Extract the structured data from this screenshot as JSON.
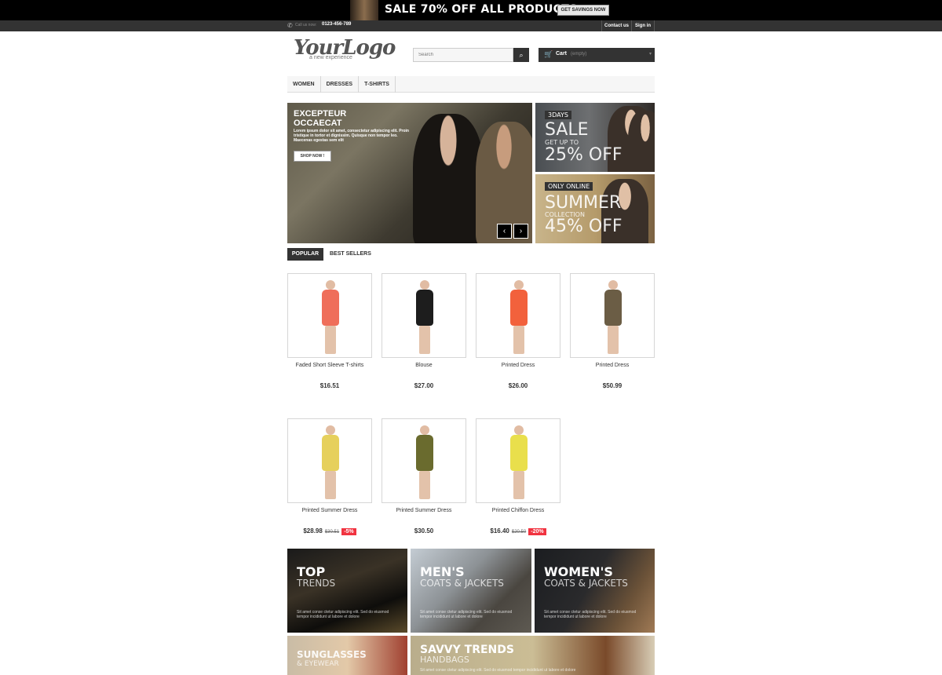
{
  "top_banner": {
    "sale_text": "SALE 70% OFF ALL PRODUCTS",
    "button_label": "GET SAVINGS NOW"
  },
  "nav_strip": {
    "call_label": "Call us now:",
    "call_number": "0123-456-789",
    "contact_label": "Contact us",
    "signin_label": "Sign in"
  },
  "header": {
    "logo_main": "YourLogo",
    "logo_tagline": "a new experience",
    "search_placeholder": "Search",
    "cart_label": "Cart",
    "cart_status": "(empty)"
  },
  "menu": {
    "items": [
      "WOMEN",
      "DRESSES",
      "T-SHIRTS"
    ]
  },
  "slider": {
    "title": "EXCEPTEUR OCCAECAT",
    "text": "Lorem ipsum dolor sit amet, consectetur adipiscing elit. Proin tristique in tortor et dignissim. Quisque non tempor leo. Maecenas egestas sem elit",
    "button_label": "SHOP NOW !"
  },
  "side_banners": {
    "sale": {
      "badge": "3DAYS",
      "big": "SALE",
      "small": "GET UP TO",
      "discount": "25% OFF"
    },
    "summer": {
      "badge": "ONLY ONLINE",
      "big": "SUMMER",
      "small": "COLLECTION",
      "discount": "45% OFF"
    }
  },
  "tabs": {
    "popular": "POPULAR",
    "best_sellers": "BEST SELLERS"
  },
  "products": [
    {
      "name": "Faded Short Sleeve T-shirts",
      "price": "$16.51",
      "old_price": "",
      "discount": "",
      "color": "#ef6e5a"
    },
    {
      "name": "Blouse",
      "price": "$27.00",
      "old_price": "",
      "discount": "",
      "color": "#1d1d1d"
    },
    {
      "name": "Printed Dress",
      "price": "$26.00",
      "old_price": "",
      "discount": "",
      "color": "#f2613c"
    },
    {
      "name": "Printed Dress",
      "price": "$50.99",
      "old_price": "",
      "discount": "",
      "color": "#6b5d45"
    },
    {
      "name": "Printed Summer Dress",
      "price": "$28.98",
      "old_price": "$30.51",
      "discount": "-5%",
      "color": "#e6d05c"
    },
    {
      "name": "Printed Summer Dress",
      "price": "$30.50",
      "old_price": "",
      "discount": "",
      "color": "#6a6b2e"
    },
    {
      "name": "Printed Chiffon Dress",
      "price": "$16.40",
      "old_price": "$20.50",
      "discount": "-20%",
      "color": "#e9df4c"
    }
  ],
  "promos": {
    "top_trends": {
      "title": "TOP",
      "sub": "TRENDS",
      "text": "Sit amet conse ctetur adipiscing elit. Sed do eiusmod tempor incididunt ut labore et dolore"
    },
    "mens": {
      "title": "MEN'S",
      "sub": "COATS & JACKETS",
      "text": "Sit amet conse ctetur adipiscing elit. Sed do eiusmod tempor incididunt ut labore et dolore"
    },
    "womens": {
      "title": "WOMEN'S",
      "sub": "COATS & JACKETS",
      "text": "Sit amet conse ctetur adipiscing elit. Sed do eiusmod tempor incididunt ut labore et dolore"
    },
    "sunglasses": {
      "title": "SUNGLASSES",
      "sub": "& EYEWEAR"
    },
    "savvy": {
      "title": "SAVVY TRENDS",
      "sub": "HANDBAGS",
      "text": "Sit amet conse ctetur adipiscing elit. Sed do eiusmod tempor incididunt ut labore et dolore"
    }
  }
}
